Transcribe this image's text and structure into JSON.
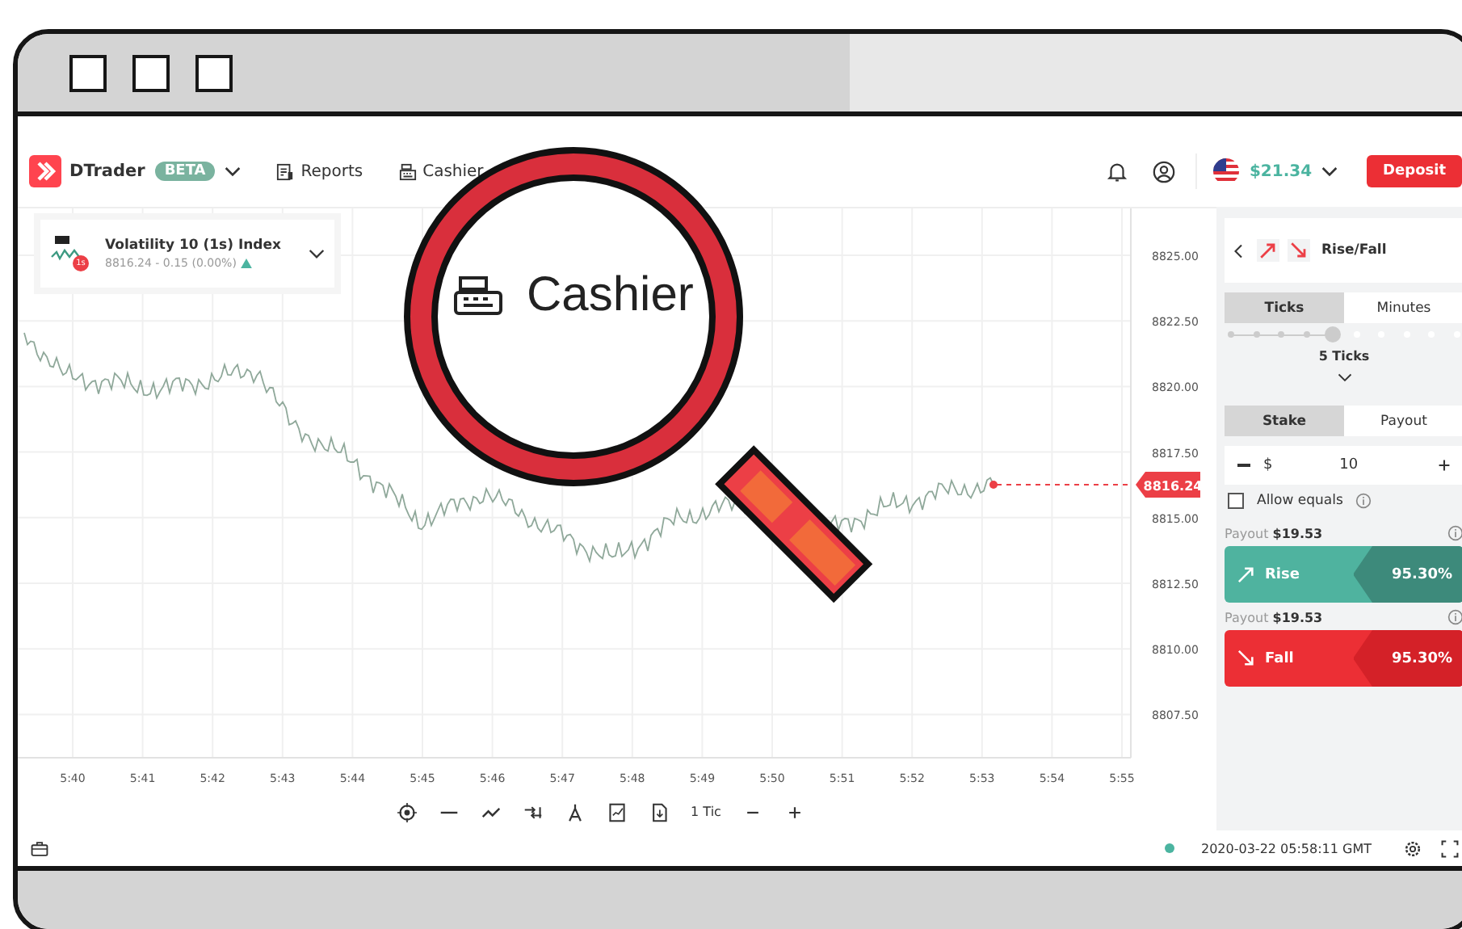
{
  "header": {
    "brand": "DTrader",
    "badge": "BETA",
    "nav": [
      {
        "label": "Reports"
      },
      {
        "label": "Cashier"
      }
    ],
    "balance": "$21.34",
    "deposit": "Deposit"
  },
  "market": {
    "name": "Volatility 10 (1s) Index",
    "badge": "1s",
    "quote": "8816.24 - 0.15 (0.00%)"
  },
  "chart": {
    "y_labels": [
      "8825.00",
      "8822.50",
      "8820.00",
      "8817.50",
      "8815.00",
      "8812.50",
      "8810.00",
      "8807.50"
    ],
    "x_labels": [
      "5:40",
      "5:41",
      "5:42",
      "5:43",
      "5:44",
      "5:45",
      "5:46",
      "5:47",
      "5:48",
      "5:49",
      "5:50",
      "5:51",
      "5:52",
      "5:53",
      "5:54",
      "5:55"
    ],
    "current_price": "8816.24"
  },
  "toolbar": {
    "interval": "1 Tic"
  },
  "trade": {
    "contract": "Rise/Fall",
    "duration_tabs": [
      {
        "label": "Ticks",
        "selected": true
      },
      {
        "label": "Minutes",
        "selected": false
      }
    ],
    "duration": {
      "level": 0.45,
      "label": "5 Ticks"
    },
    "amount_tabs": [
      {
        "label": "Stake",
        "selected": true
      },
      {
        "label": "Payout",
        "selected": false
      }
    ],
    "currency": "$",
    "amount": "10",
    "allow_equals": {
      "label": "Allow equals",
      "checked": false
    },
    "purchase": [
      {
        "kind": "rise",
        "payout_label": "Payout",
        "payout": "$19.53",
        "label": "Rise",
        "percent": "95.30%"
      },
      {
        "kind": "fall",
        "payout_label": "Payout",
        "payout": "$19.53",
        "label": "Fall",
        "percent": "95.30%"
      }
    ]
  },
  "footer": {
    "time": "2020-03-22 05:58:11 GMT"
  },
  "magnifier": {
    "label": "Cashier"
  }
}
